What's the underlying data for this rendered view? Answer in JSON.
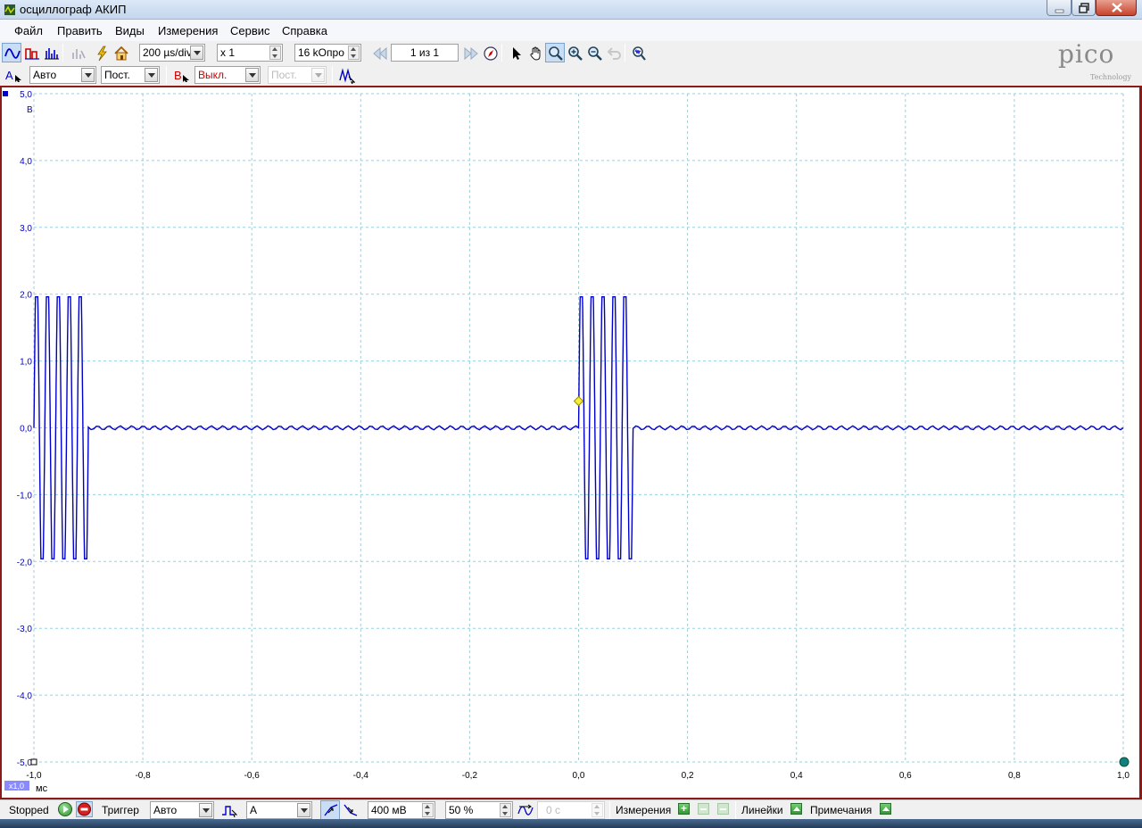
{
  "window": {
    "title": "осциллограф АКИП"
  },
  "menu": [
    {
      "label": "Файл"
    },
    {
      "label": "Править"
    },
    {
      "label": "Виды"
    },
    {
      "label": "Измерения"
    },
    {
      "label": "Сервис"
    },
    {
      "label": "Справка"
    }
  ],
  "toolbar": {
    "timebase": "200 µs/div",
    "zoom": "x 1",
    "samples": "16 kОпро",
    "buffer": "1 из 1"
  },
  "channels": {
    "a_label": "A",
    "a_range": "Авто",
    "a_coupling": "Пост.",
    "b_label": "B",
    "b_range": "Выкл.",
    "b_coupling": "Пост."
  },
  "logo": {
    "brand": "pico",
    "sub": "Technology"
  },
  "colors": {
    "trace": "#0000cc",
    "grid": "#9ad0dc",
    "frame": "#8b1a1a",
    "axis_text": "#0000cc"
  },
  "plot": {
    "y_unit": "В",
    "x_unit": "мс",
    "x_zoom_badge": "x1,0",
    "y_ticks": [
      "5,0",
      "4,0",
      "3,0",
      "2,0",
      "1,0",
      "0,0",
      "-1,0",
      "-2,0",
      "-3,0",
      "-4,0",
      "-5,0"
    ],
    "x_ticks": [
      "-1,0",
      "-0,8",
      "-0,6",
      "-0,4",
      "-0,2",
      "0,0",
      "0,2",
      "0,4",
      "0,6",
      "0,8",
      "1,0"
    ]
  },
  "chart_data": {
    "type": "line",
    "xlim": [
      -1.0,
      1.0
    ],
    "ylim": [
      -5.0,
      5.0
    ],
    "xlabel": "мс",
    "ylabel": "В",
    "grid": true,
    "series": [
      {
        "bursts": [
          {
            "start_ms": -1.0,
            "end_ms": -0.9,
            "amplitude_v": 2.0,
            "cycles": 5
          },
          {
            "start_ms": 0.0,
            "end_ms": 0.1,
            "amplitude_v": 2.0,
            "cycles": 5
          }
        ],
        "baseline_v": 0.0
      }
    ],
    "trigger_marker": {
      "x_ms": 0.0,
      "y_v": 0.4
    }
  },
  "status": {
    "state": "Stopped",
    "trigger_label": "Триггер",
    "trigger_mode": "Авто",
    "trigger_source": "A",
    "threshold": "400 мВ",
    "pre_trigger": "50 %",
    "delay": "0 с",
    "measurements": "Измерения",
    "rulers": "Линейки",
    "notes": "Примечания"
  }
}
